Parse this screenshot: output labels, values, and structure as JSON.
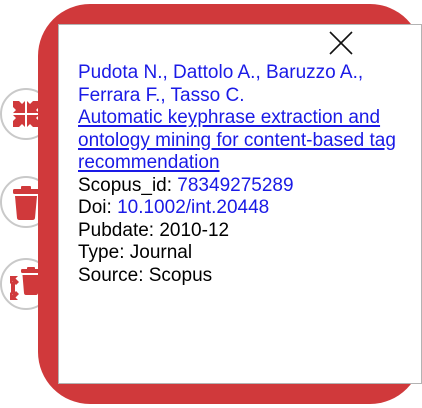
{
  "record": {
    "authors": "Pudota N., Dattolo A., Baruzzo A., Ferrara F., Tasso C.",
    "title": "Automatic keyphrase extraction and ontology mining for content-based tag recommendation",
    "scopus_label": "Scopus_id: ",
    "scopus_id": "78349275289",
    "doi_label": "Doi: ",
    "doi": "10.1002/int.20448",
    "pubdate": "Pubdate: 2010-12",
    "type": "Type: Journal",
    "source": "Source: Scopus"
  },
  "colors": {
    "accent": "#d0393b",
    "link": "#1a1ae6",
    "button_border": "#c9c9c9"
  },
  "icons": {
    "close": "close-icon",
    "collapse": "collapse-arrows-icon",
    "delete": "trash-icon",
    "move": "move-trash-icon"
  }
}
